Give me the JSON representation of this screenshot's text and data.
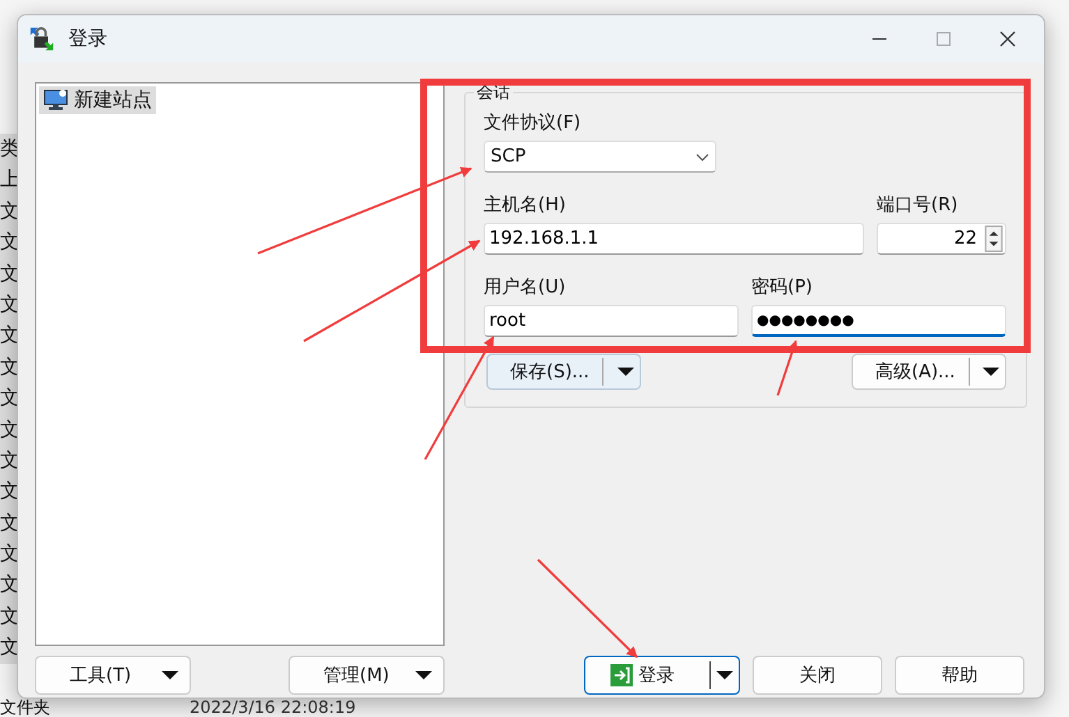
{
  "background_window": {
    "column_1": [
      "类",
      "上",
      "文",
      "文",
      "文",
      "文",
      "文",
      "文",
      "文",
      "文",
      "文",
      "文",
      "文",
      "文",
      "文",
      "文",
      "文"
    ],
    "bottom_row": {
      "name": "文件夹",
      "modified": "2022/3/16  22:08:19"
    }
  },
  "window": {
    "title": "登录"
  },
  "sites": [
    {
      "label": "新建站点",
      "selected": true
    }
  ],
  "session": {
    "title": "会话",
    "protocol": {
      "label": "文件协议(F)",
      "value": "SCP"
    },
    "host": {
      "label": "主机名(H)",
      "value": "192.168.1.1"
    },
    "port": {
      "label": "端口号(R)",
      "value": "22"
    },
    "user": {
      "label": "用户名(U)",
      "value": "root",
      "focused": false
    },
    "password": {
      "label": "密码(P)",
      "value": "●●●●●●●●",
      "focused": true
    },
    "save_button": "保存(S)...",
    "advanced_button": "高级(A)..."
  },
  "left_buttons": [
    "工具(T)",
    "管理(M)"
  ],
  "dialog_buttons": [
    {
      "label": "登录",
      "default": true
    },
    {
      "label": "关闭",
      "default": false
    },
    {
      "label": "帮助",
      "default": false
    }
  ]
}
